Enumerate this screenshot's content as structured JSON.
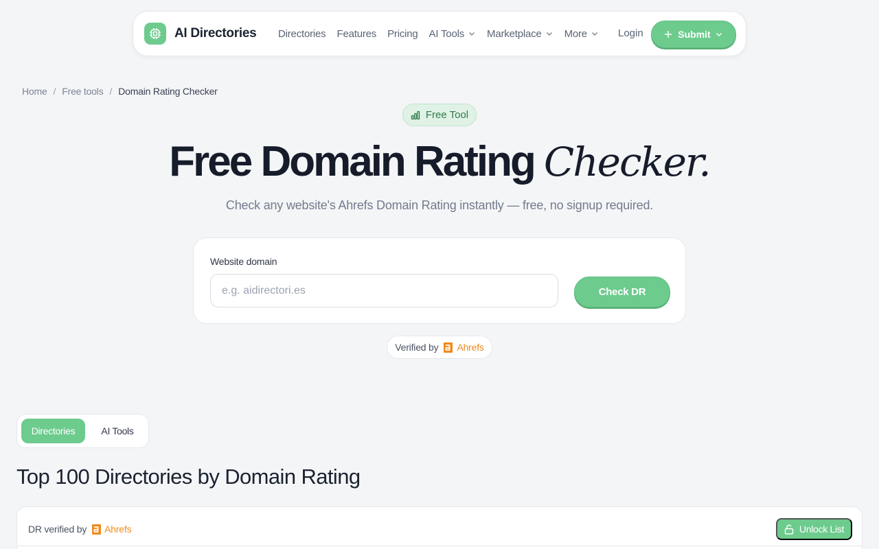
{
  "colors": {
    "accent": "#6dcb8e",
    "ahrefs": "#f08a1c",
    "background": "#f4f5f7"
  },
  "header": {
    "brand": "AI Directories",
    "logo_icon": "chip-icon",
    "nav": [
      {
        "label": "Directories",
        "has_menu": false
      },
      {
        "label": "Features",
        "has_menu": false
      },
      {
        "label": "Pricing",
        "has_menu": false
      },
      {
        "label": "AI Tools",
        "has_menu": true
      },
      {
        "label": "Marketplace",
        "has_menu": true
      },
      {
        "label": "More",
        "has_menu": true
      }
    ],
    "login": "Login",
    "submit": "Submit"
  },
  "breadcrumb": {
    "home": "Home",
    "parent": "Free tools",
    "current": "Domain Rating Checker",
    "separator": "/"
  },
  "hero": {
    "badge": "Free Tool",
    "title": "Free Domain Rating",
    "title_italic": "Checker.",
    "subtitle": "Check any website's Ahrefs Domain Rating instantly — free, no signup required."
  },
  "checker": {
    "label": "Website domain",
    "placeholder": "e.g. aidirectori.es",
    "value": "",
    "button": "Check DR"
  },
  "verified": {
    "prefix": "Verified by",
    "provider": "Ahrefs"
  },
  "tabs": {
    "active": "Directories",
    "inactive": "AI Tools"
  },
  "section_title": "Top 100 Directories by Domain Rating",
  "table": {
    "verified_prefix": "DR verified by",
    "provider": "Ahrefs",
    "unlock": "Unlock List"
  }
}
